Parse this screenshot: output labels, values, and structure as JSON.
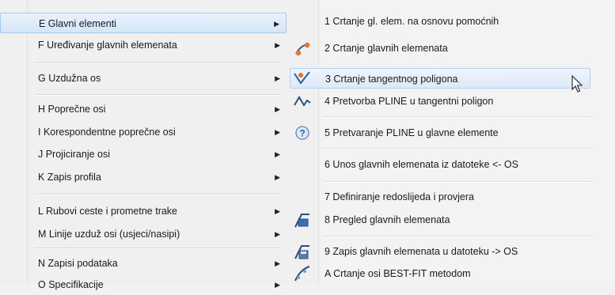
{
  "left_menu": {
    "items": [
      {
        "label": "E Glavni elementi",
        "arrow": "▶",
        "highlighted": true
      },
      {
        "label": "F Uređivanje glavnih elemenata",
        "arrow": "▶"
      },
      {
        "label": "G Uzdužna os",
        "arrow": "▶"
      },
      {
        "label": "H Poprečne osi",
        "arrow": "▶"
      },
      {
        "label": "I Korespondentne poprečne osi",
        "arrow": "▶"
      },
      {
        "label": "J Projiciranje osi",
        "arrow": "▶"
      },
      {
        "label": "K Zapis profila",
        "arrow": "▶"
      },
      {
        "label": "L Rubovi ceste i prometne trake",
        "arrow": "▶"
      },
      {
        "label": "M Linije uzduž osi (usjeci/nasipi)",
        "arrow": "▶"
      },
      {
        "label": "N Zapisi podataka",
        "arrow": "▶"
      },
      {
        "label": "O Specifikacije",
        "arrow": "▶"
      }
    ]
  },
  "submenu": {
    "items": [
      {
        "label": "1 Crtanje gl. elem. na osnovu pomoćnih",
        "icon": "none"
      },
      {
        "label": "2 Crtanje glavnih elemenata",
        "icon": "draw-elements-icon"
      },
      {
        "label": "3 Crtanje tangentnog poligona",
        "icon": "tangent-polygon-icon",
        "highlighted": true
      },
      {
        "label": "4 Pretvorba PLINE u tangentni poligon",
        "icon": "pline-wave-icon"
      },
      {
        "label": "5 Pretvaranje PLINE u glavne elemente",
        "icon": "question-icon"
      },
      {
        "label": "6 Unos glavnih elemenata iz datoteke <- OS",
        "icon": "none"
      },
      {
        "label": "7 Definiranje redoslijeda i provjera",
        "icon": "none"
      },
      {
        "label": "8 Pregled glavnih elemenata",
        "icon": "preview-elements-icon"
      },
      {
        "label": "9 Zapis glavnih elemenata u datoteku -> OS",
        "icon": "write-file-icon"
      },
      {
        "label": "A Crtanje osi BEST-FIT metodom",
        "icon": "best-fit-icon"
      }
    ]
  },
  "colors": {
    "highlight": "#d5e6f8",
    "highlight_border": "#a8c8ea",
    "icon_orange": "#e0762a",
    "icon_blue": "#3a6fb0"
  }
}
